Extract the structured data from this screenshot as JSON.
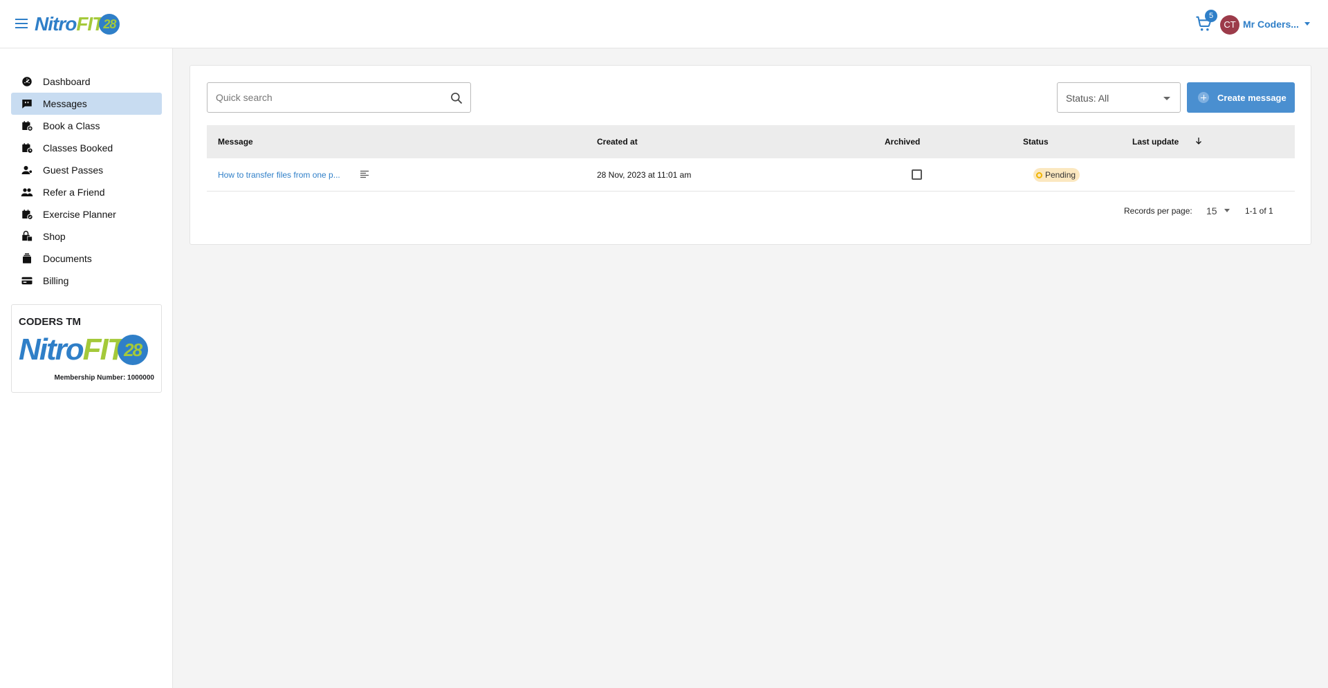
{
  "header": {
    "logo": {
      "part1": "Nitro",
      "part2": "FIT",
      "part3": "28"
    },
    "cart_count": "5",
    "avatar_initials": "CT",
    "user_name": "Mr Coders..."
  },
  "sidebar": {
    "items": [
      {
        "label": "Dashboard",
        "icon": "dashboard-icon"
      },
      {
        "label": "Messages",
        "icon": "message-icon",
        "active": true
      },
      {
        "label": "Book a Class",
        "icon": "calendar-add-icon"
      },
      {
        "label": "Classes Booked",
        "icon": "calendar-clock-icon"
      },
      {
        "label": "Guest Passes",
        "icon": "person-icon"
      },
      {
        "label": "Refer a Friend",
        "icon": "people-icon"
      },
      {
        "label": "Exercise Planner",
        "icon": "calendar-plan-icon"
      },
      {
        "label": "Shop",
        "icon": "shop-icon"
      },
      {
        "label": "Documents",
        "icon": "documents-icon"
      },
      {
        "label": "Billing",
        "icon": "credit-card-icon"
      }
    ],
    "member_card": {
      "title": "CODERS TM",
      "logo": {
        "part1": "Nitro",
        "part2": "FIT",
        "part3": "28"
      },
      "membership_number": "Membership Number: 1000000"
    }
  },
  "toolbar": {
    "search_placeholder": "Quick search",
    "status_filter": "Status: All",
    "create_label": "Create message"
  },
  "table": {
    "columns": [
      "Message",
      "Created at",
      "Archived",
      "Status",
      "Last update"
    ],
    "rows": [
      {
        "message": "How to transfer files from one p...",
        "created_at": "28 Nov, 2023 at 11:01 am",
        "archived": false,
        "status": "Pending",
        "last_update": ""
      }
    ]
  },
  "pagination": {
    "label": "Records per page:",
    "per_page": "15",
    "range": "1-1 of 1"
  },
  "colors": {
    "brand_blue": "#2f7fc8",
    "brand_green": "#a4c93a",
    "active_nav": "#c8dcf1",
    "button_blue": "#4a8fd0",
    "pending_badge": "#fbe8c0"
  }
}
